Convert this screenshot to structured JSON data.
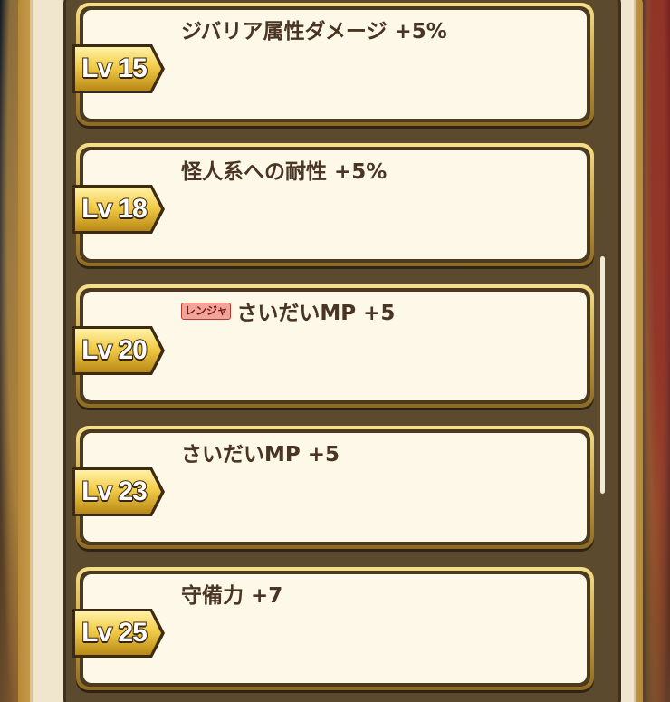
{
  "skills": [
    {
      "level_label": "Lv 15",
      "text": "ジバリア属性ダメージ +5%",
      "tag": null
    },
    {
      "level_label": "Lv 18",
      "text": "怪人系への耐性 +5%",
      "tag": null
    },
    {
      "level_label": "Lv 20",
      "text": "さいだいMP +5",
      "tag": "レンジャ"
    },
    {
      "level_label": "Lv 23",
      "text": "さいだいMP +5",
      "tag": null
    },
    {
      "level_label": "Lv 25",
      "text": "守備力 +7",
      "tag": null
    }
  ]
}
